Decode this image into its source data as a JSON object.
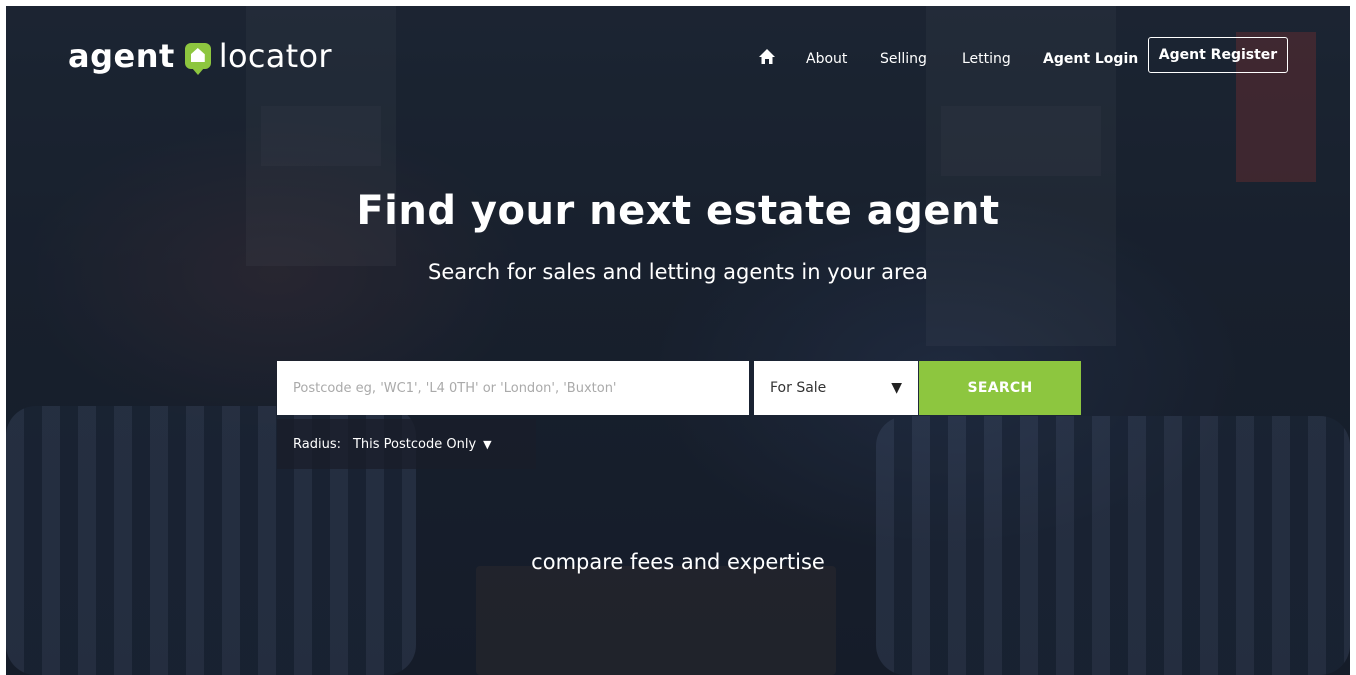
{
  "header": {
    "logo": {
      "part1": "agent",
      "part2": "locator"
    },
    "nav": {
      "home_icon": "home-icon",
      "about": "About",
      "selling": "Selling",
      "letting": "Letting",
      "agent_login": "Agent Login",
      "agent_register": "Agent Register"
    }
  },
  "hero": {
    "title": "Find your next estate agent",
    "subtitle": "Search for sales and letting agents in your area"
  },
  "search": {
    "placeholder": "Postcode eg, 'WC1', 'L4 0TH' or 'London', 'Buxton'",
    "type_selected": "For Sale",
    "button": "SEARCH",
    "radius_label": "Radius:",
    "radius_selected": "This Postcode Only"
  },
  "tagline": "compare fees and expertise",
  "colors": {
    "accent": "#8dc63f",
    "text": "#ffffff",
    "overlay": "#1f2836"
  }
}
